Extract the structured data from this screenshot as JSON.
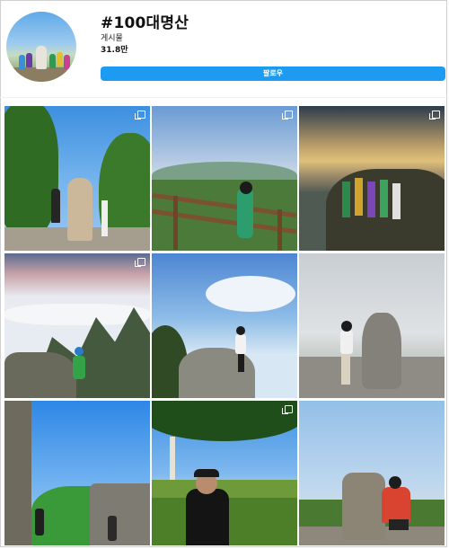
{
  "profile": {
    "hashtag_title": "#100대명산",
    "posts_label": "게시물",
    "posts_count": "31.8만",
    "follow_label": "팔로우"
  },
  "grid": {
    "tiles": [
      {
        "scene": "summit-stone-forest",
        "multi": true
      },
      {
        "scene": "hiker-fence-clouds",
        "multi": true
      },
      {
        "scene": "group-sunrise-peak",
        "multi": true
      },
      {
        "scene": "cloud-sea-hiker",
        "multi": true
      },
      {
        "scene": "hiker-sitting-rock",
        "multi": false
      },
      {
        "scene": "hiker-summit-stone",
        "multi": false
      },
      {
        "scene": "stone-wall-hikers",
        "multi": false
      },
      {
        "scene": "hiker-tree-meadow",
        "multi": true
      },
      {
        "scene": "summit-marker-hiker",
        "multi": false
      }
    ]
  },
  "colors": {
    "accent": "#1d9bf0",
    "multi_icon": "#ffffff"
  }
}
